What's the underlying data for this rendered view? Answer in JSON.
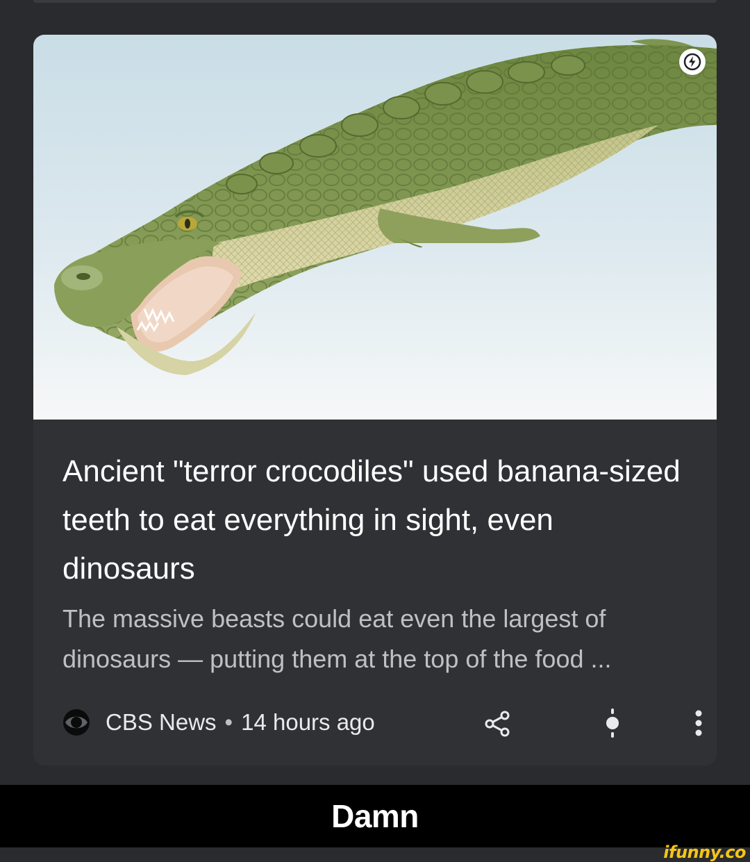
{
  "article": {
    "headline": "Ancient \"terror crocodiles\" used banana-sized teeth to eat everything in sight, even dinosaurs",
    "snippet": "The massive beasts could eat even the largest of dinosaurs — putting them at the top of the food ...",
    "source": "CBS News",
    "separator": "•",
    "time_ago": "14 hours ago",
    "image_alt": "Illustration of a giant crocodile with open jaws"
  },
  "icons": {
    "amp": "lightning-bolt-icon",
    "source": "cbs-eye-icon",
    "share": "share-icon",
    "mute": "notification-toggle-icon",
    "more": "more-vertical-icon"
  },
  "caption": {
    "text": "Damn"
  },
  "watermark": {
    "text": "ifunny.co"
  },
  "colors": {
    "page_bg": "#2a2b2e",
    "card_bg": "#303134",
    "headline": "#ffffff",
    "snippet": "#bdc1c6",
    "watermark": "#f5c518"
  }
}
